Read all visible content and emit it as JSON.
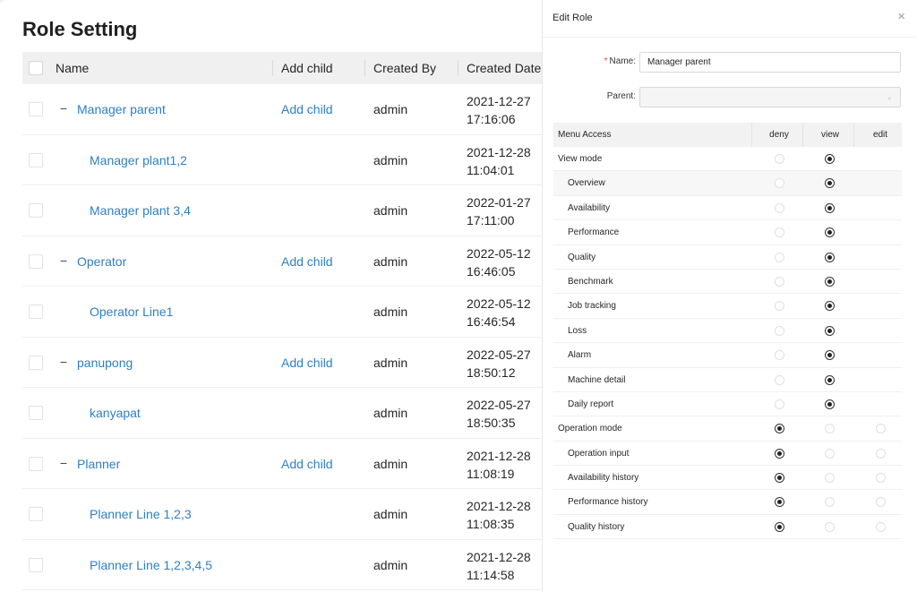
{
  "page": {
    "title": "Role Setting"
  },
  "table": {
    "columns": {
      "name": "Name",
      "add_child": "Add child",
      "created_by": "Created By",
      "created_date": "Created Date"
    },
    "rows": [
      {
        "name": "Manager parent",
        "add_child": "Add child",
        "created_by": "admin",
        "date": "2021-12-27",
        "time": "17:16:06",
        "collapse": "−",
        "level": 0
      },
      {
        "name": "Manager plant1,2",
        "add_child": "",
        "created_by": "admin",
        "date": "2021-12-28",
        "time": "11:04:01",
        "collapse": "",
        "level": 1
      },
      {
        "name": "Manager plant 3,4",
        "add_child": "",
        "created_by": "admin",
        "date": "2022-01-27",
        "time": "17:11:00",
        "collapse": "",
        "level": 1
      },
      {
        "name": "Operator",
        "add_child": "Add child",
        "created_by": "admin",
        "date": "2022-05-12",
        "time": "16:46:05",
        "collapse": "−",
        "level": 0
      },
      {
        "name": "Operator Line1",
        "add_child": "",
        "created_by": "admin",
        "date": "2022-05-12",
        "time": "16:46:54",
        "collapse": "",
        "level": 1
      },
      {
        "name": "panupong",
        "add_child": "Add child",
        "created_by": "admin",
        "date": "2022-05-27",
        "time": "18:50:12",
        "collapse": "−",
        "level": 0
      },
      {
        "name": "kanyapat",
        "add_child": "",
        "created_by": "admin",
        "date": "2022-05-27",
        "time": "18:50:35",
        "collapse": "",
        "level": 1
      },
      {
        "name": "Planner",
        "add_child": "Add child",
        "created_by": "admin",
        "date": "2021-12-28",
        "time": "11:08:19",
        "collapse": "−",
        "level": 0
      },
      {
        "name": "Planner Line 1,2,3",
        "add_child": "",
        "created_by": "admin",
        "date": "2021-12-28",
        "time": "11:08:35",
        "collapse": "",
        "level": 1
      },
      {
        "name": "Planner Line 1,2,3,4,5",
        "add_child": "",
        "created_by": "admin",
        "date": "2021-12-28",
        "time": "11:14:58",
        "collapse": "",
        "level": 1
      }
    ]
  },
  "drawer": {
    "title": "Edit Role",
    "close_icon": "×",
    "name_label": "Name",
    "name_required_mark": "*",
    "name_colon": ":",
    "name_value": "Manager parent",
    "parent_label": "Parent",
    "parent_colon": ":",
    "parent_value": "",
    "select_icon": "⌄",
    "matrix": {
      "columns": {
        "menu": "Menu Access",
        "deny": "deny",
        "view": "view",
        "edit": "edit"
      },
      "rows": [
        {
          "label": "View mode",
          "level": 0,
          "selected": "view",
          "radios": [
            "deny",
            "view"
          ]
        },
        {
          "label": "Overview",
          "level": 1,
          "selected": "view",
          "radios": [
            "deny",
            "view"
          ]
        },
        {
          "label": "Availability",
          "level": 1,
          "selected": "view",
          "radios": [
            "deny",
            "view"
          ]
        },
        {
          "label": "Performance",
          "level": 1,
          "selected": "view",
          "radios": [
            "deny",
            "view"
          ]
        },
        {
          "label": "Quality",
          "level": 1,
          "selected": "view",
          "radios": [
            "deny",
            "view"
          ]
        },
        {
          "label": "Benchmark",
          "level": 1,
          "selected": "view",
          "radios": [
            "deny",
            "view"
          ]
        },
        {
          "label": "Job tracking",
          "level": 1,
          "selected": "view",
          "radios": [
            "deny",
            "view"
          ]
        },
        {
          "label": "Loss",
          "level": 1,
          "selected": "view",
          "radios": [
            "deny",
            "view"
          ]
        },
        {
          "label": "Alarm",
          "level": 1,
          "selected": "view",
          "radios": [
            "deny",
            "view"
          ]
        },
        {
          "label": "Machine detail",
          "level": 1,
          "selected": "view",
          "radios": [
            "deny",
            "view"
          ]
        },
        {
          "label": "Daily report",
          "level": 1,
          "selected": "view",
          "radios": [
            "deny",
            "view"
          ]
        },
        {
          "label": "Operation mode",
          "level": 0,
          "selected": "deny",
          "radios": [
            "deny",
            "view",
            "edit"
          ]
        },
        {
          "label": "Operation input",
          "level": 1,
          "selected": "deny",
          "radios": [
            "deny",
            "view",
            "edit"
          ]
        },
        {
          "label": "Availability history",
          "level": 1,
          "selected": "deny",
          "radios": [
            "deny",
            "view",
            "edit"
          ]
        },
        {
          "label": "Performance history",
          "level": 1,
          "selected": "deny",
          "radios": [
            "deny",
            "view",
            "edit"
          ]
        },
        {
          "label": "Quality history",
          "level": 1,
          "selected": "deny",
          "radios": [
            "deny",
            "view",
            "edit"
          ]
        }
      ]
    }
  },
  "colors": {
    "link": "#2f7fc2",
    "required": "#e2463e",
    "header_bg": "#f0f0f0"
  }
}
